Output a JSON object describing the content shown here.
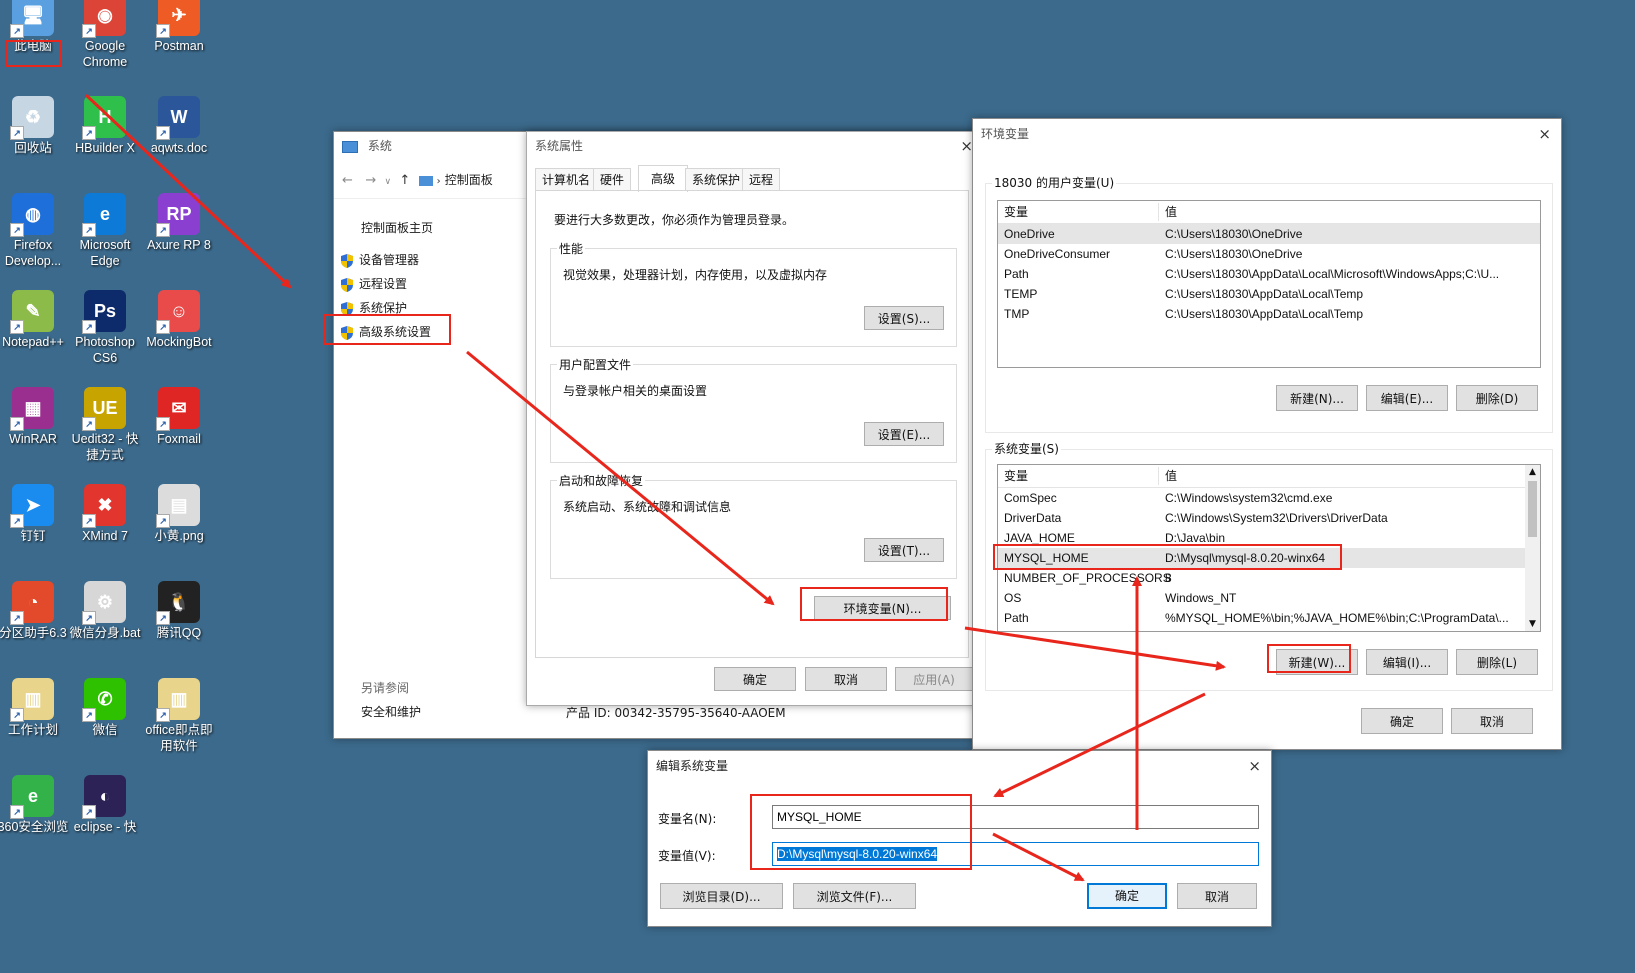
{
  "desktop": {
    "icons": [
      {
        "label": "此电脑",
        "glyph": "🖥",
        "bg": "#5aa0e0"
      },
      {
        "label": "Google Chrome",
        "glyph": "◉",
        "bg": "#db4437"
      },
      {
        "label": "Postman",
        "glyph": "✈",
        "bg": "#ef5b25"
      },
      {
        "label": "回收站",
        "glyph": "♻",
        "bg": "#c7d6e3"
      },
      {
        "label": "HBuilder X",
        "glyph": "H",
        "bg": "#2fbf4b"
      },
      {
        "label": "aqwts.doc",
        "glyph": "W",
        "bg": "#2b579a"
      },
      {
        "label": "Firefox Develop...",
        "glyph": "◍",
        "bg": "#1e6fd9"
      },
      {
        "label": "Microsoft Edge",
        "glyph": "e",
        "bg": "#0c7ad6"
      },
      {
        "label": "Axure RP 8",
        "glyph": "RP",
        "bg": "#8b3fd1"
      },
      {
        "label": "Notepad++",
        "glyph": "✎",
        "bg": "#8dbb4a"
      },
      {
        "label": "Photoshop CS6",
        "glyph": "Ps",
        "bg": "#0d2a6b"
      },
      {
        "label": "MockingBot",
        "glyph": "☺",
        "bg": "#e94b4b"
      },
      {
        "label": "WinRAR",
        "glyph": "▦",
        "bg": "#9b2f8f"
      },
      {
        "label": "Uedit32 - 快捷方式",
        "glyph": "UE",
        "bg": "#c8a400"
      },
      {
        "label": "Foxmail",
        "glyph": "✉",
        "bg": "#e02525"
      },
      {
        "label": "钉钉",
        "glyph": "➤",
        "bg": "#1a8cf0"
      },
      {
        "label": "XMind 7",
        "glyph": "✖",
        "bg": "#e1352d"
      },
      {
        "label": "小黄.png",
        "glyph": "▤",
        "bg": "#dcdcdc"
      },
      {
        "label": "分区助手6.3",
        "glyph": "◔",
        "bg": "#e24a2b"
      },
      {
        "label": "微信分身.bat",
        "glyph": "⚙",
        "bg": "#d7d7d7"
      },
      {
        "label": "腾讯QQ",
        "glyph": "🐧",
        "bg": "#222222"
      },
      {
        "label": "工作计划",
        "glyph": "▥",
        "bg": "#e8d48a"
      },
      {
        "label": "微信",
        "glyph": "✆",
        "bg": "#2dc100"
      },
      {
        "label": "office即点即用软件",
        "glyph": "▥",
        "bg": "#e8d48a"
      },
      {
        "label": "360安全浏览",
        "glyph": "e",
        "bg": "#34b24a"
      },
      {
        "label": "eclipse - 快",
        "glyph": "◐",
        "bg": "#2c2255"
      }
    ]
  },
  "system_window": {
    "title": "系统",
    "breadcrumb": "控制面板",
    "home_link": "控制面板主页",
    "links": [
      "设备管理器",
      "远程设置",
      "系统保护",
      "高级系统设置"
    ],
    "see_also_title": "另请参阅",
    "see_also_link": "安全和维护",
    "product_id": "产品 ID: 00342-35795-35640-AAOEM"
  },
  "sysprops_window": {
    "title": "系统属性",
    "tabs": [
      "计算机名",
      "硬件",
      "高级",
      "系统保护",
      "远程"
    ],
    "notice": "要进行大多数更改，你必须作为管理员登录。",
    "perf_title": "性能",
    "perf_desc": "视觉效果，处理器计划，内存使用，以及虚拟内存",
    "perf_btn": "设置(S)...",
    "profile_title": "用户配置文件",
    "profile_desc": "与登录帐户相关的桌面设置",
    "profile_btn": "设置(E)...",
    "startup_title": "启动和故障恢复",
    "startup_desc": "系统启动、系统故障和调试信息",
    "startup_btn": "设置(T)...",
    "env_btn": "环境变量(N)...",
    "ok": "确定",
    "cancel": "取消",
    "apply": "应用(A)"
  },
  "env_window": {
    "title": "环境变量",
    "user_group": "18030 的用户变量(U)",
    "col_var": "变量",
    "col_val": "值",
    "user_vars": [
      {
        "name": "OneDrive",
        "value": "C:\\Users\\18030\\OneDrive"
      },
      {
        "name": "OneDriveConsumer",
        "value": "C:\\Users\\18030\\OneDrive"
      },
      {
        "name": "Path",
        "value": "C:\\Users\\18030\\AppData\\Local\\Microsoft\\WindowsApps;C:\\U..."
      },
      {
        "name": "TEMP",
        "value": "C:\\Users\\18030\\AppData\\Local\\Temp"
      },
      {
        "name": "TMP",
        "value": "C:\\Users\\18030\\AppData\\Local\\Temp"
      }
    ],
    "user_new": "新建(N)...",
    "user_edit": "编辑(E)...",
    "user_delete": "删除(D)",
    "sys_group": "系统变量(S)",
    "sys_vars": [
      {
        "name": "ComSpec",
        "value": "C:\\Windows\\system32\\cmd.exe"
      },
      {
        "name": "DriverData",
        "value": "C:\\Windows\\System32\\Drivers\\DriverData"
      },
      {
        "name": "JAVA_HOME",
        "value": "D:\\Java\\bin"
      },
      {
        "name": "MYSQL_HOME",
        "value": "D:\\Mysql\\mysql-8.0.20-winx64"
      },
      {
        "name": "NUMBER_OF_PROCESSORS",
        "value": "8"
      },
      {
        "name": "OS",
        "value": "Windows_NT"
      },
      {
        "name": "Path",
        "value": "%MYSQL_HOME%\\bin;%JAVA_HOME%\\bin;C:\\ProgramData\\..."
      }
    ],
    "sys_new": "新建(W)...",
    "sys_edit": "编辑(I)...",
    "sys_delete": "删除(L)",
    "ok": "确定",
    "cancel": "取消"
  },
  "edit_dialog": {
    "title": "编辑系统变量",
    "name_label": "变量名(N):",
    "value_label": "变量值(V):",
    "name_value": "MYSQL_HOME",
    "value_value": "D:\\Mysql\\mysql-8.0.20-winx64",
    "browse_dir": "浏览目录(D)...",
    "browse_file": "浏览文件(F)...",
    "ok": "确定",
    "cancel": "取消"
  },
  "colors": {
    "desktop": "#3c6a8c",
    "annotation_red": "#e8261c",
    "accent": "#0078d7",
    "selection": "#0078d7"
  }
}
